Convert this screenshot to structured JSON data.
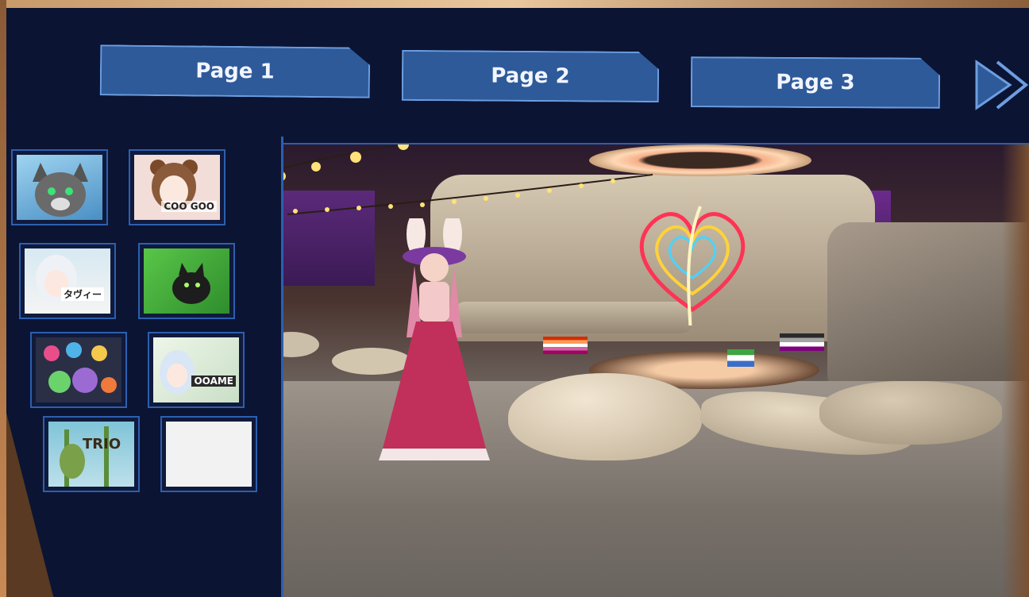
{
  "pagination": {
    "tabs": [
      {
        "label": "Page 1"
      },
      {
        "label": "Page 2"
      },
      {
        "label": "Page 3"
      }
    ],
    "next_icon": "double-chevron-right-icon"
  },
  "avatar_thumbnails": [
    {
      "name": "gray-wolf-avatar",
      "text": ""
    },
    {
      "name": "coo-goo-avatar",
      "text": "COO GOO"
    },
    {
      "name": "white-hair-avatar",
      "text": "タヴィー"
    },
    {
      "name": "green-cat-avatar",
      "text": ""
    },
    {
      "name": "colorful-characters-avatar",
      "text": ""
    },
    {
      "name": "ooame-avatar",
      "text": "OOAME"
    },
    {
      "name": "trio-avatar",
      "text": "TRIO"
    },
    {
      "name": "empty-slot",
      "text": ""
    }
  ],
  "colors": {
    "panel_bg": "#0b1433",
    "tab_fill": "#2e5a9a",
    "accent_border": "#2d5fae"
  }
}
